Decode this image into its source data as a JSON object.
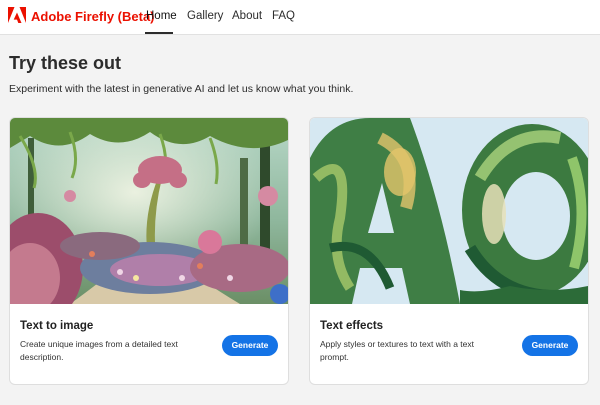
{
  "header": {
    "brand": "Adobe Firefly (Beta)",
    "nav": [
      "Home",
      "Gallery",
      "About",
      "FAQ"
    ],
    "brand_color": "#eb1000"
  },
  "main": {
    "title": "Try these out",
    "subtitle": "Experiment with the latest in generative AI and let us know what you think."
  },
  "cards": [
    {
      "title": "Text to image",
      "description": "Create unique images from a detailed text description.",
      "button": "Generate",
      "image": "fantasy-garden-illustration"
    },
    {
      "title": "Text effects",
      "description": "Apply styles or textures to text with a text prompt.",
      "button": "Generate",
      "image": "leafy-letters-AO"
    }
  ],
  "colors": {
    "accent": "#1473e6",
    "background": "#f3f3f3"
  }
}
